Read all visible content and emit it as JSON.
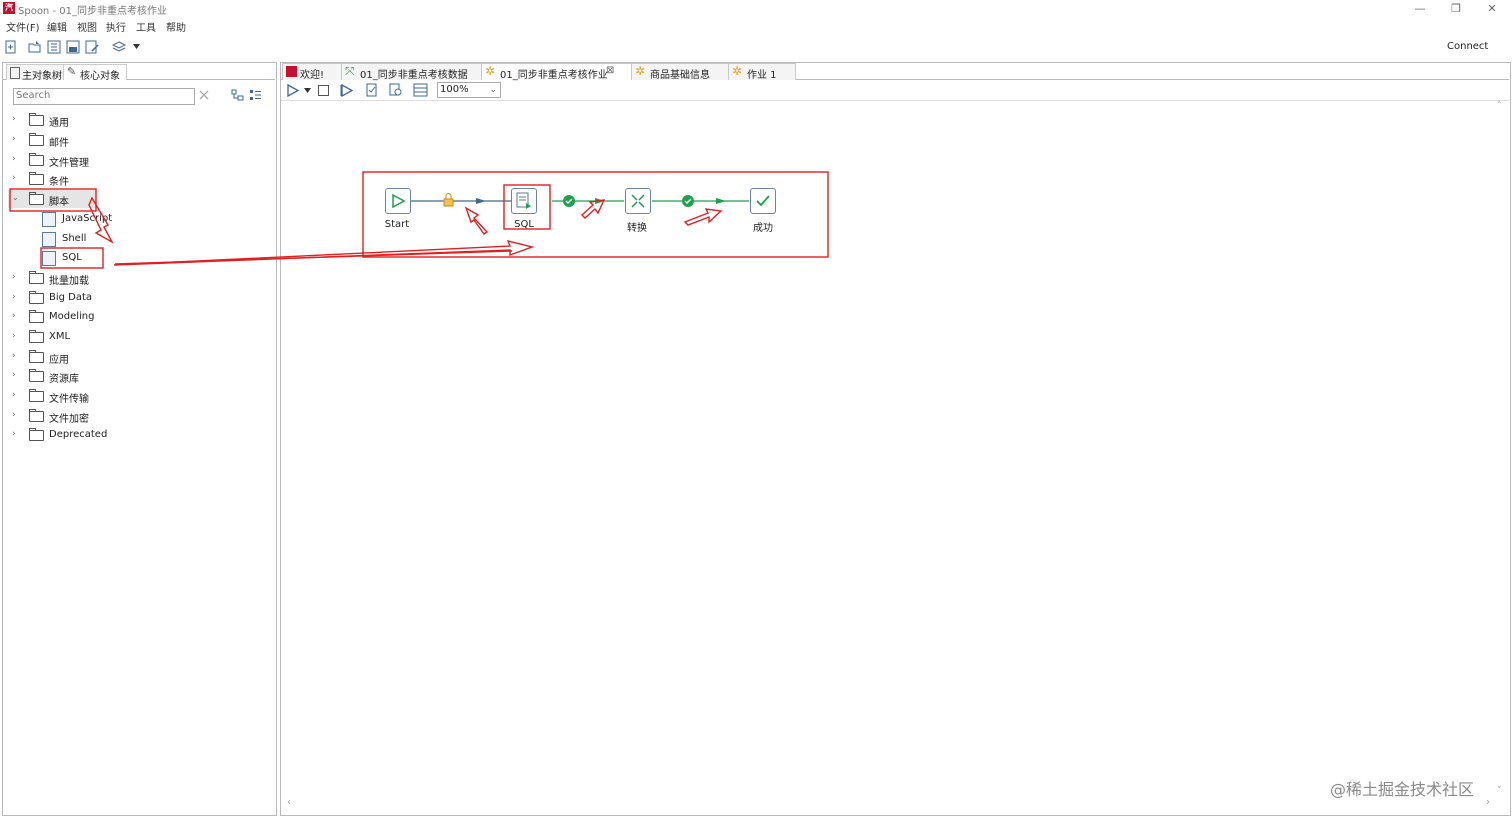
{
  "window": {
    "title": "Spoon - 01_同步非重点考核作业",
    "app_icon_text": "汽"
  },
  "menu": [
    "文件(F)",
    "编辑",
    "视图",
    "执行",
    "工具",
    "帮助"
  ],
  "toolbar": {
    "connect_label": "Connect"
  },
  "left_panel": {
    "tabs": [
      "主对象树",
      "核心对象"
    ],
    "search": {
      "value": "",
      "placeholder": "Search"
    },
    "tree": [
      {
        "label": "通用",
        "expanded": false
      },
      {
        "label": "邮件",
        "expanded": false
      },
      {
        "label": "文件管理",
        "expanded": false
      },
      {
        "label": "条件",
        "expanded": false
      },
      {
        "label": "脚本",
        "expanded": true,
        "children": [
          "JavaScript",
          "Shell",
          "SQL"
        ]
      },
      {
        "label": "批量加载",
        "expanded": false
      },
      {
        "label": "Big Data",
        "expanded": false
      },
      {
        "label": "Modeling",
        "expanded": false
      },
      {
        "label": "XML",
        "expanded": false
      },
      {
        "label": "应用",
        "expanded": false
      },
      {
        "label": "资源库",
        "expanded": false
      },
      {
        "label": "文件传输",
        "expanded": false
      },
      {
        "label": "文件加密",
        "expanded": false
      },
      {
        "label": "Deprecated",
        "expanded": false
      }
    ]
  },
  "editor": {
    "tabs": [
      {
        "label": "欢迎!",
        "icon": "spoon-icon",
        "active": false
      },
      {
        "label": "01_同步非重点考核数据",
        "icon": "transformation-icon",
        "active": false
      },
      {
        "label": "01_同步非重点考核作业",
        "icon": "job-icon",
        "active": true,
        "closable": true
      },
      {
        "label": "商品基础信息",
        "icon": "job-icon",
        "active": false
      },
      {
        "label": "作业 1",
        "icon": "job-icon",
        "active": false
      }
    ],
    "zoom": "100%",
    "close_symbol": "⊠"
  },
  "job": {
    "nodes": [
      {
        "label": "Start",
        "icon": "play-icon"
      },
      {
        "label": "SQL",
        "icon": "sql-icon"
      },
      {
        "label": "转换",
        "icon": "transform-icon"
      },
      {
        "label": "成功",
        "icon": "check-icon"
      }
    ]
  },
  "watermark": "@稀土掘金技术社区",
  "colors": {
    "annotation_red": "#e02020",
    "hop_blue": "#3f6a8c",
    "hop_green": "#1aa34a",
    "lock_yellow": "#e8a317",
    "title_icon": "#c8102e"
  }
}
